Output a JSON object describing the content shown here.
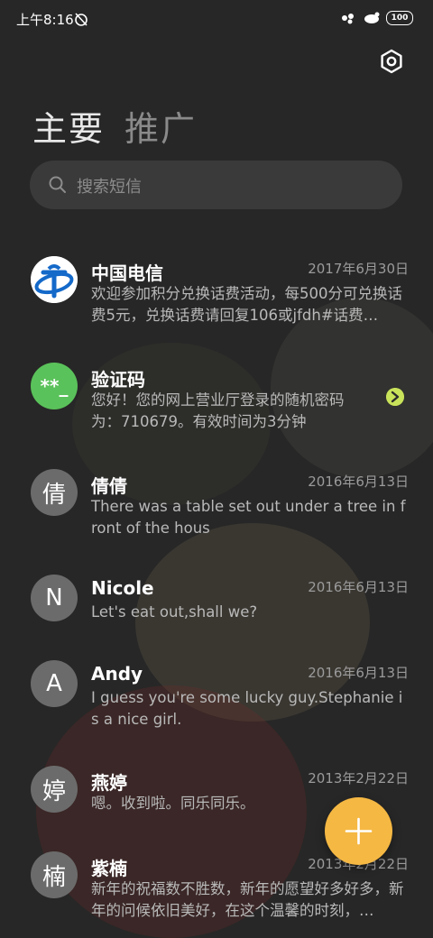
{
  "status_bar": {
    "time": "上午8:16",
    "battery": "100"
  },
  "tabs": [
    {
      "label": "主要",
      "active": true
    },
    {
      "label": "推广",
      "active": false
    }
  ],
  "search": {
    "placeholder": "搜索短信"
  },
  "messages": [
    {
      "name": "中国电信",
      "date": "2017年6月30日",
      "preview": "欢迎参加积分兑换话费活动，每500分可兑换话费5元，兑换话费请回复106或jfdh#话费…",
      "avatar": "telecom-logo"
    },
    {
      "name": "验证码",
      "date": "",
      "preview": "您好！您的网上营业厅登录的随机密码为：710679。有效时间为3分钟",
      "avatar_text": "**_",
      "avatar_color": "#5ac25a"
    },
    {
      "name": "倩倩",
      "date": "2016年6月13日",
      "preview": "There was a table set out under a tree in front of the hous",
      "avatar_text": "倩"
    },
    {
      "name": "Nicole",
      "date": "2016年6月13日",
      "preview": "Let's eat out,shall we?",
      "avatar_text": "N"
    },
    {
      "name": "Andy",
      "date": "2016年6月13日",
      "preview": "I guess you're some lucky guy.Stephanie is a nice girl.",
      "avatar_text": "A"
    },
    {
      "name": "燕婷",
      "date": "2013年2月22日",
      "preview": "嗯。收到啦。同乐同乐。",
      "avatar_text": "婷"
    },
    {
      "name": "紫楠",
      "date": "2013年2月22日",
      "preview": "新年的祝福数不胜数，新年的愿望好多好多，新年的问候依旧美好，在这个温馨的时刻，…",
      "avatar_text": "楠"
    }
  ],
  "colors": {
    "accent_fab": "#f5b843",
    "verify_avatar": "#5ac25a",
    "telecom_blue": "#1469c9"
  }
}
